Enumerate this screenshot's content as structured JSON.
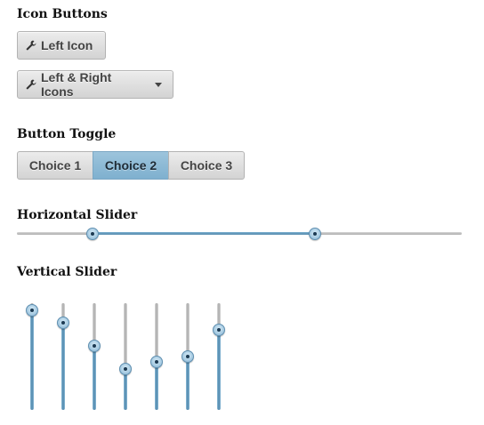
{
  "sections": {
    "icon_buttons": "Icon Buttons",
    "button_toggle": "Button Toggle",
    "horizontal_slider": "Horizontal Slider",
    "vertical_slider": "Vertical Slider"
  },
  "buttons": {
    "left_icon": {
      "label": "Left Icon",
      "icon": "wrench-icon"
    },
    "left_right_icons": {
      "label": "Left & Right Icons",
      "icon": "wrench-icon",
      "right_icon": "caret-down-icon"
    }
  },
  "toggle": {
    "choices": [
      "Choice 1",
      "Choice 2",
      "Choice 3"
    ],
    "selected_index": 1
  },
  "horizontal_slider": {
    "min": 0,
    "max": 100,
    "low": 17,
    "high": 67
  },
  "vertical_sliders": {
    "min": 0,
    "max": 100,
    "values": [
      93,
      82,
      60,
      38,
      45,
      50,
      75
    ]
  },
  "colors": {
    "accent": "#7fb0cf",
    "track": "#b5b5b5",
    "button_bg": "#e0e0e0"
  }
}
